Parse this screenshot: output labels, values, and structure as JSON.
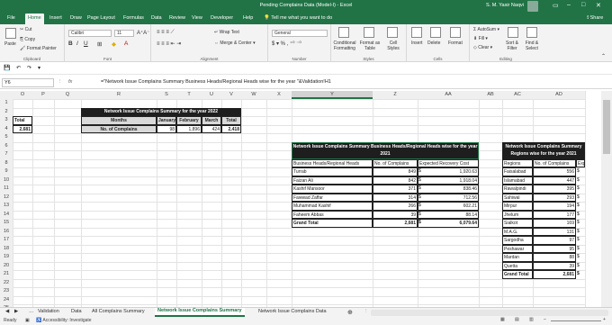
{
  "title": "Pending Complains Data (Model-I) - Excel",
  "user": "S. M. Yasir Naqvi",
  "tabs": [
    "File",
    "Home",
    "Insert",
    "Draw",
    "Page Layout",
    "Formulas",
    "Data",
    "Review",
    "View",
    "Developer",
    "Help"
  ],
  "tellme": "Tell me what you want to do",
  "share": "Share",
  "ribbon": {
    "paste": "Paste",
    "cut": "Cut",
    "copy": "Copy",
    "format_painter": "Format Painter",
    "clipboard": "Clipboard",
    "font_name": "Calibri",
    "font_size": "11",
    "font": "Font",
    "wrap_text": "Wrap Text",
    "merge_center": "Merge & Center",
    "alignment": "Alignment",
    "number_format": "General",
    "number": "Number",
    "conditional_formatting": "Conditional Formatting",
    "format_as_table": "Format as Table",
    "cell_styles": "Cell Styles",
    "styles": "Styles",
    "insert": "Insert",
    "delete": "Delete",
    "format": "Format",
    "cells": "Cells",
    "autosum": "AutoSum",
    "fill": "Fill",
    "clear": "Clear",
    "sort_filter": "Sort & Filter",
    "find_select": "Find & Select",
    "editing": "Editing"
  },
  "namebox": "Y6",
  "formula": "=\"Network Issue Complains Summary Business Heads/Regional Heads wise for the year \"&Validation!H1",
  "columns": [
    "O",
    "P",
    "Q",
    "R",
    "S",
    "T",
    "U",
    "V",
    "W",
    "X",
    "Y",
    "Z",
    "AA",
    "AB",
    "AC",
    "AD"
  ],
  "rows": [
    "1",
    "2",
    "3",
    "4",
    "5",
    "6",
    "7",
    "8",
    "9",
    "10",
    "11",
    "12",
    "13",
    "14",
    "15",
    "16",
    "17",
    "18",
    "19",
    "20",
    "21",
    "22",
    "23",
    "24",
    "25"
  ],
  "left_total": {
    "header": "Total",
    "value": "2,681"
  },
  "summary": {
    "title": "Network Issue Complains Summary for the year 2022",
    "headers": [
      "Months",
      "January",
      "February",
      "March",
      "Total"
    ],
    "row_label": "No. of Complains",
    "values": [
      "98",
      "1,896",
      "424",
      "2,418"
    ]
  },
  "bh_table": {
    "title": "Network Issue Complains Summary Business Heads/Regional Heads wise for the year 2021",
    "headers": [
      "Business Heads/Regional Heads",
      "No. of Complains",
      "Expected Recovery Cost"
    ],
    "rows": [
      [
        "Turrab",
        "849",
        "$",
        "1,920.63"
      ],
      [
        "Faizan Ali",
        "842",
        "$",
        "1,918.04"
      ],
      [
        "Kashif Mansoor",
        "371",
        "$",
        "838.46"
      ],
      [
        "Fawwad Zaffar",
        "314",
        "$",
        "712.56"
      ],
      [
        "Muhammad Kashif",
        "266",
        "$",
        "602.21"
      ],
      [
        "Faheem Abbas",
        "39",
        "$",
        "88.14"
      ]
    ],
    "total": [
      "Grand Total",
      "2,681",
      "$",
      "6,079.64"
    ]
  },
  "region_table": {
    "title": "Network Issue Complains Summary Regions wise for the year 2021",
    "headers": [
      "Regions",
      "No. of Complains",
      "Expected"
    ],
    "rows": [
      [
        "Faisalabad",
        "556",
        "$"
      ],
      [
        "Islamabad",
        "447",
        "$"
      ],
      [
        "Rawalpindi",
        "395",
        "$"
      ],
      [
        "Sahiwal",
        "293",
        "$"
      ],
      [
        "Mirpur",
        "194",
        "$"
      ],
      [
        "Jhelum",
        "177",
        "$"
      ],
      [
        "Sialkot",
        "169",
        "$"
      ],
      [
        "M.A.G.",
        "131",
        "$"
      ],
      [
        "Sargodha",
        "97",
        "$"
      ],
      [
        "Peshawar",
        "95",
        "$"
      ],
      [
        "Mardan",
        "88",
        "$"
      ],
      [
        "Quetta",
        "39",
        "$"
      ]
    ],
    "total": [
      "Grand Total",
      "2,681",
      "$"
    ]
  },
  "sheet_tabs": [
    "Validation",
    "Data",
    "All Complains Summary",
    "Network Issue Complains Summary",
    "Network Issue Complains Data"
  ],
  "active_sheet": "Network Issue Complains Summary",
  "status": {
    "ready": "Ready",
    "accessibility": "Accessibility: Investigate"
  },
  "colors": {
    "excel_green": "#217346",
    "table_header": "#1e1e1e",
    "total_row": "#d9d9d9"
  }
}
